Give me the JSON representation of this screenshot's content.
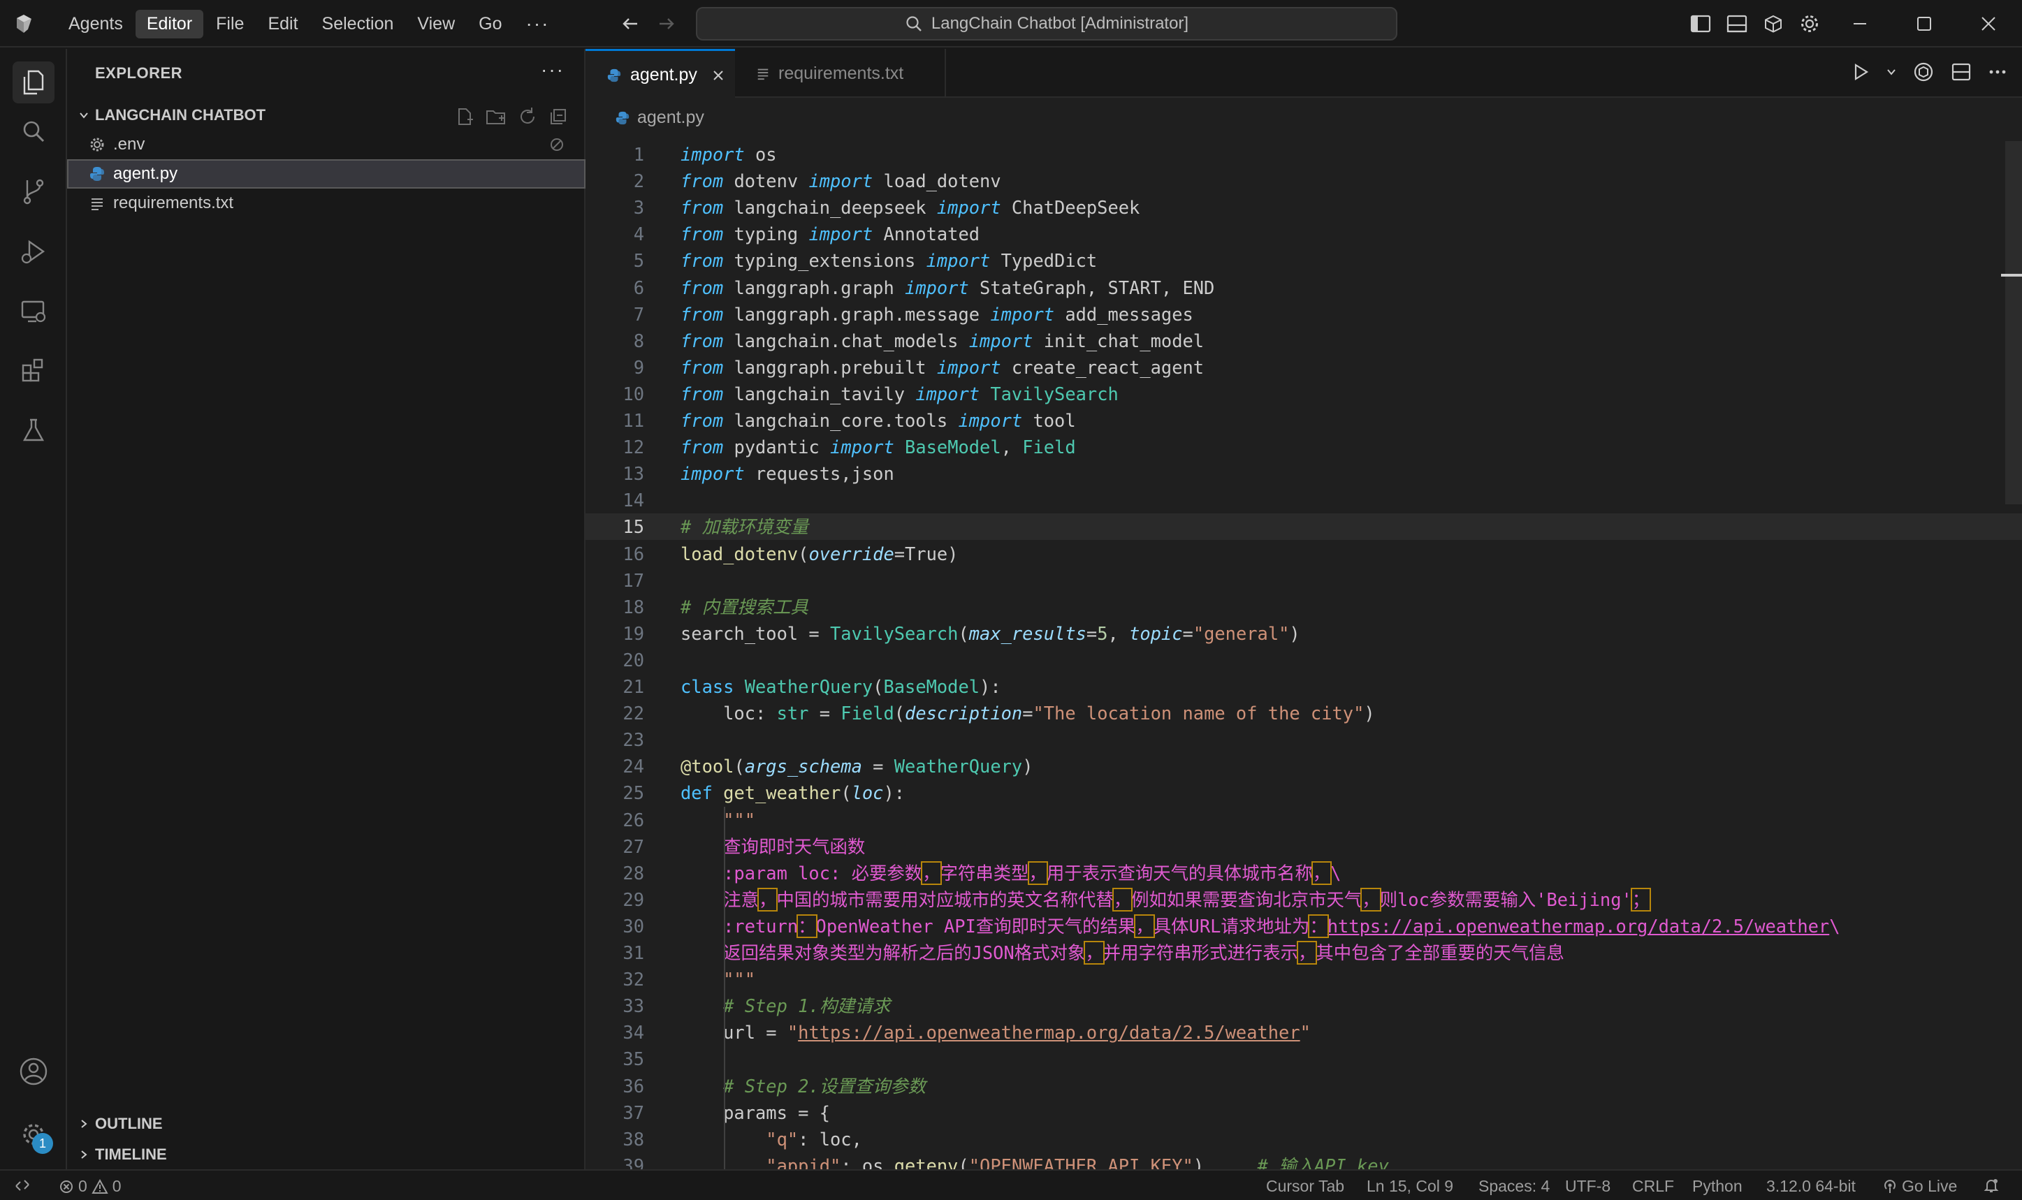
{
  "titlebar": {
    "menus": [
      "Agents",
      "Editor",
      "File",
      "Edit",
      "Selection",
      "View",
      "Go"
    ],
    "active_menu": "Editor",
    "more": "···",
    "search_text": "LangChain Chatbot [Administrator]"
  },
  "sidebar": {
    "title": "EXPLORER",
    "more": "···",
    "folder": "LANGCHAIN CHATBOT",
    "files": [
      {
        "name": ".env",
        "icon": "gear-icon"
      },
      {
        "name": "agent.py",
        "icon": "python-icon",
        "selected": true
      },
      {
        "name": "requirements.txt",
        "icon": "lines-icon"
      }
    ],
    "outline": "OUTLINE",
    "timeline": "TIMELINE",
    "settings_badge": "1"
  },
  "editor": {
    "tabs": [
      {
        "label": "agent.py",
        "active": true
      },
      {
        "label": "requirements.txt",
        "active": false
      }
    ],
    "breadcrumb": "agent.py",
    "current_line": 15,
    "colors": {
      "keyword": "#4fc1ff",
      "comment": "#6a9955",
      "function": "#dcdcaa",
      "class": "#4ec9b0",
      "string": "#ce9178",
      "docstring": "#e05ad0"
    },
    "lines": [
      {
        "n": "1",
        "t": "import os"
      },
      {
        "n": "2",
        "t": "from dotenv import load_dotenv"
      },
      {
        "n": "3",
        "t": "from langchain_deepseek import ChatDeepSeek"
      },
      {
        "n": "4",
        "t": "from typing import Annotated"
      },
      {
        "n": "5",
        "t": "from typing_extensions import TypedDict"
      },
      {
        "n": "6",
        "t": "from langgraph.graph import StateGraph, START, END"
      },
      {
        "n": "7",
        "t": "from langgraph.graph.message import add_messages"
      },
      {
        "n": "8",
        "t": "from langchain.chat_models import init_chat_model"
      },
      {
        "n": "9",
        "t": "from langgraph.prebuilt import create_react_agent"
      },
      {
        "n": "10",
        "t": "from langchain_tavily import TavilySearch"
      },
      {
        "n": "11",
        "t": "from langchain_core.tools import tool"
      },
      {
        "n": "12",
        "t": "from pydantic import BaseModel, Field"
      },
      {
        "n": "13",
        "t": "import requests,json"
      },
      {
        "n": "14",
        "t": ""
      },
      {
        "n": "15",
        "t": "# 加载环境变量"
      },
      {
        "n": "16",
        "t": "load_dotenv(override=True)"
      },
      {
        "n": "17",
        "t": ""
      },
      {
        "n": "18",
        "t": "# 内置搜索工具"
      },
      {
        "n": "19",
        "t": "search_tool = TavilySearch(max_results=5, topic=\"general\")"
      },
      {
        "n": "20",
        "t": ""
      },
      {
        "n": "21",
        "t": "class WeatherQuery(BaseModel):"
      },
      {
        "n": "22",
        "t": "    loc: str = Field(description=\"The location name of the city\")"
      },
      {
        "n": "23",
        "t": ""
      },
      {
        "n": "24",
        "t": "@tool(args_schema = WeatherQuery)"
      },
      {
        "n": "25",
        "t": "def get_weather(loc):"
      },
      {
        "n": "26",
        "t": "    \"\"\""
      },
      {
        "n": "27",
        "t": "    查询即时天气函数"
      },
      {
        "n": "28",
        "t": "    :param loc: 必要参数，字符串类型，用于表示查询天气的具体城市名称，\\"
      },
      {
        "n": "29",
        "t": "    注意，中国的城市需要用对应城市的英文名称代替，例如如果需要查询北京市天气，则loc参数需要输入'Beijing'；"
      },
      {
        "n": "30",
        "t": "    :return：OpenWeather API查询即时天气的结果，具体URL请求地址为：https://api.openweathermap.org/data/2.5/weather\\"
      },
      {
        "n": "31",
        "t": "    返回结果对象类型为解析之后的JSON格式对象，并用字符串形式进行表示，其中包含了全部重要的天气信息"
      },
      {
        "n": "32",
        "t": "    \"\"\""
      },
      {
        "n": "33",
        "t": "    # Step 1.构建请求"
      },
      {
        "n": "34",
        "t": "    url = \"https://api.openweathermap.org/data/2.5/weather\""
      },
      {
        "n": "35",
        "t": ""
      },
      {
        "n": "36",
        "t": "    # Step 2.设置查询参数"
      },
      {
        "n": "37",
        "t": "    params = {"
      },
      {
        "n": "38",
        "t": "        \"q\": loc,"
      },
      {
        "n": "39",
        "t": "        \"appid\": os.getenv(\"OPENWEATHER_API_KEY\"),    # 输入API key"
      }
    ]
  },
  "statusbar": {
    "errors": "0",
    "warnings": "0",
    "cursor_tab": "Cursor Tab",
    "position": "Ln 15, Col 9",
    "spaces": "Spaces: 4",
    "encoding": "UTF-8",
    "eol": "CRLF",
    "language": "Python",
    "interpreter": "3.12.0 64-bit",
    "go_live": "Go Live"
  }
}
